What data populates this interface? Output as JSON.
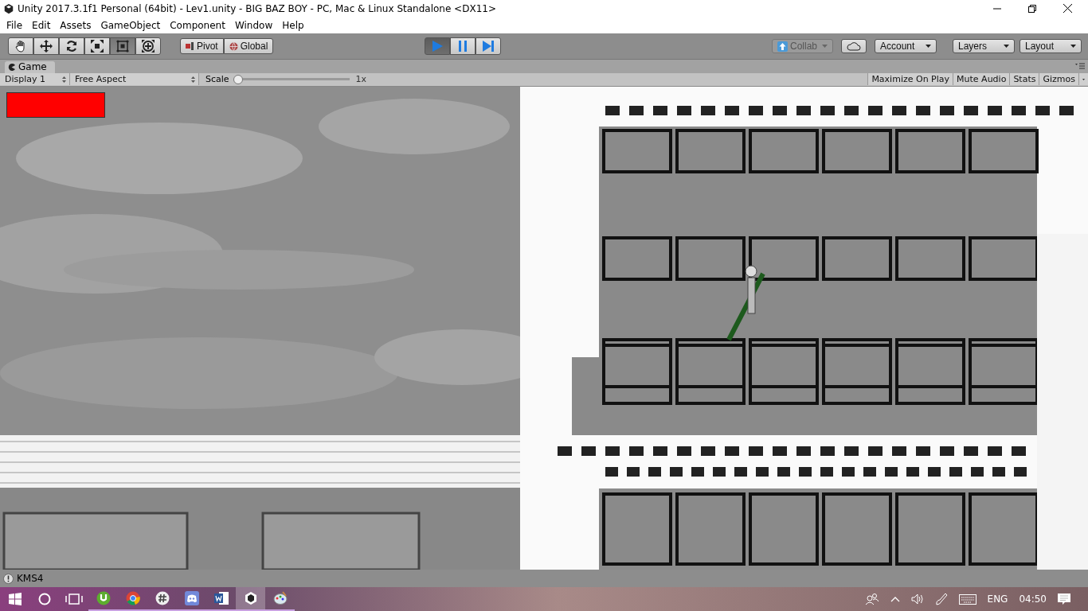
{
  "window": {
    "title": "Unity 2017.3.1f1 Personal (64bit) - Lev1.unity - BIG BAZ BOY - PC, Mac & Linux Standalone <DX11>"
  },
  "menu": [
    "File",
    "Edit",
    "Assets",
    "GameObject",
    "Component",
    "Window",
    "Help"
  ],
  "toolbar": {
    "tools": [
      {
        "kind": "hand",
        "selected": false
      },
      {
        "kind": "move",
        "selected": false
      },
      {
        "kind": "rotate",
        "selected": false
      },
      {
        "kind": "scale",
        "selected": false
      },
      {
        "kind": "rect",
        "selected": true
      },
      {
        "kind": "transform",
        "selected": false
      }
    ],
    "pivot": "Pivot",
    "global": "Global",
    "playback": [
      {
        "kind": "play",
        "selected": true
      },
      {
        "kind": "pause",
        "selected": false
      },
      {
        "kind": "step",
        "selected": false
      }
    ],
    "collab": "Collab",
    "account": "Account",
    "layers": "Layers",
    "layout": "Layout"
  },
  "game_panel": {
    "tab": "Game",
    "display": "Display 1",
    "aspect": "Free Aspect",
    "scale_label": "Scale",
    "scale": {
      "level": 0,
      "reading": "1x"
    },
    "toggles": [
      {
        "label": "Maximize On Play",
        "on": false
      },
      {
        "label": "Mute Audio",
        "on": false
      },
      {
        "label": "Stats",
        "on": false
      },
      {
        "label": "Gizmos",
        "on": false
      }
    ]
  },
  "status_bar": {
    "message": "KMS4"
  },
  "taskbar": {
    "apps": [
      {
        "kind": "torrent",
        "selected": false
      },
      {
        "kind": "browser",
        "selected": false
      },
      {
        "kind": "chat",
        "selected": false
      },
      {
        "kind": "voice",
        "selected": false
      },
      {
        "kind": "word",
        "selected": false
      },
      {
        "kind": "unity",
        "selected": true
      },
      {
        "kind": "paint",
        "selected": false
      }
    ],
    "language": "ENG",
    "time": "04:50"
  }
}
